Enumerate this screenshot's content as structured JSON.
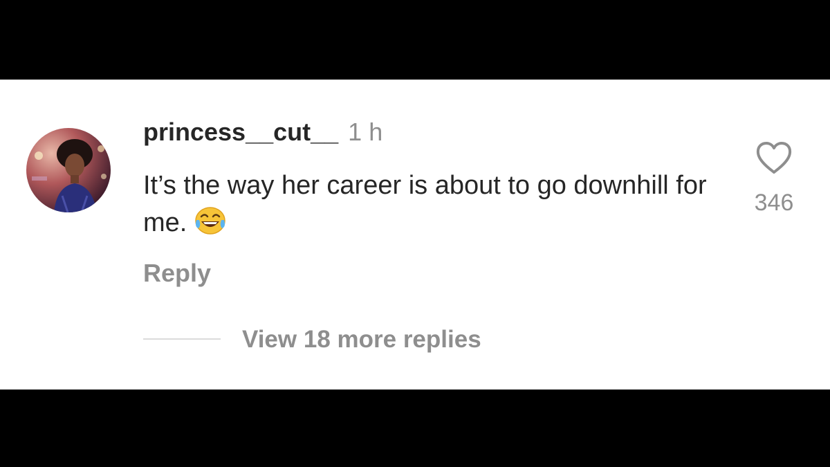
{
  "comment": {
    "username": "princess__cut__",
    "timestamp": "1 h",
    "text": "It’s the way her career is about to go downhill for me.",
    "emoji": "face-with-tears-of-joy",
    "reply_label": "Reply",
    "view_replies_label": "View 18 more replies",
    "like_count": "346"
  },
  "colors": {
    "letterbox": "#000000",
    "panel": "#ffffff",
    "primary_text": "#262626",
    "secondary_text": "#8e8e8e"
  },
  "icons": {
    "like": "heart-outline-icon",
    "emoji": "laughing-tears-emoji-icon"
  }
}
